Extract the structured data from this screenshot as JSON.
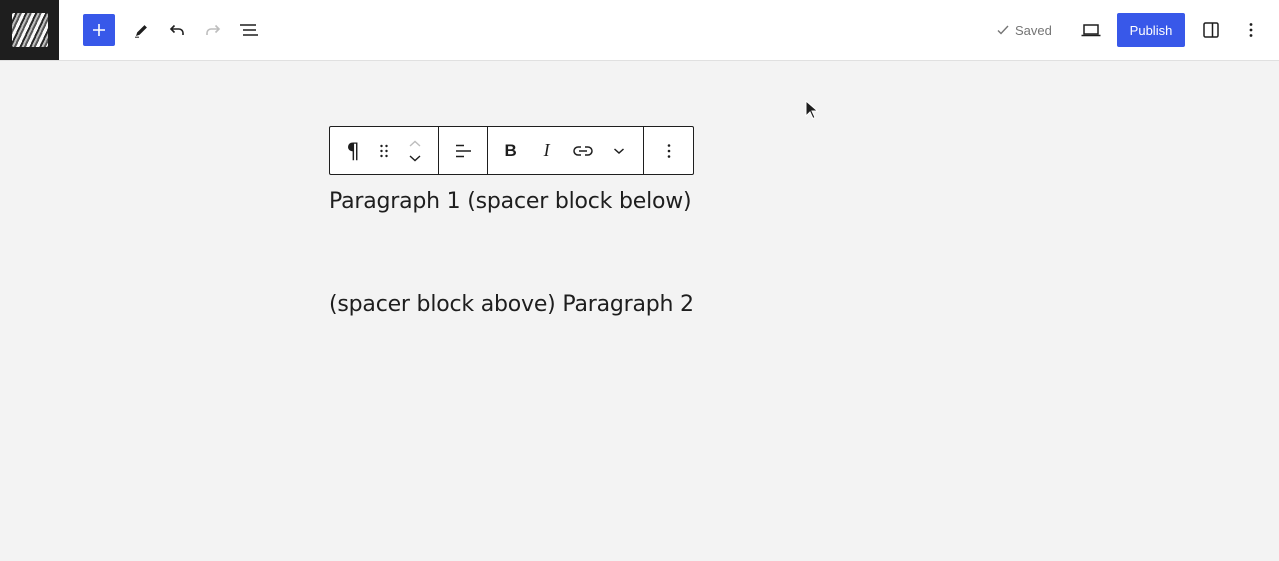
{
  "header": {
    "saved_label": "Saved",
    "publish_label": "Publish"
  },
  "icons": {
    "add": "plus-icon",
    "tools": "pencil-icon",
    "undo": "undo-icon",
    "redo": "redo-icon",
    "list_view": "list-view-icon",
    "saved": "check-icon",
    "preview": "laptop-icon",
    "settings": "sidebar-panel-icon",
    "options": "more-vertical-icon"
  },
  "block_toolbar": {
    "paragraph_icon": "¶",
    "bold": "B",
    "italic": "I"
  },
  "content": {
    "paragraph1": "Paragraph 1 (spacer block below)",
    "paragraph2": "(spacer block above) Paragraph 2"
  },
  "colors": {
    "accent": "#3858e9",
    "canvas": "#f3f3f3",
    "logo_bg": "#1e1e1e"
  }
}
